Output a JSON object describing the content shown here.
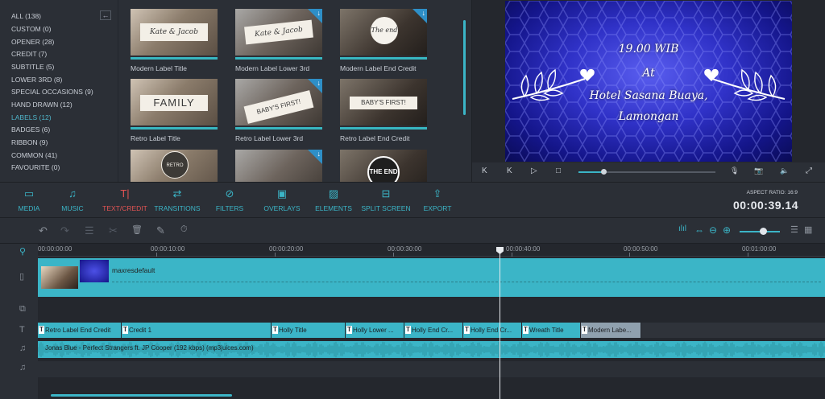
{
  "library": {
    "categories": [
      {
        "label": "ALL (138)"
      },
      {
        "label": "CUSTOM (0)"
      },
      {
        "label": "OPENER (28)"
      },
      {
        "label": "CREDIT (7)"
      },
      {
        "label": "SUBTITLE (5)"
      },
      {
        "label": "LOWER 3RD (8)"
      },
      {
        "label": "SPECIAL OCCASIONS (9)"
      },
      {
        "label": "HAND DRAWN (12)"
      },
      {
        "label": "LABELS (12)"
      },
      {
        "label": "BADGES (6)"
      },
      {
        "label": "RIBBON (9)"
      },
      {
        "label": "COMMON (41)"
      },
      {
        "label": "FAVOURITE (0)"
      }
    ],
    "active_category": "LABELS (12)",
    "collapse_glyph": "←",
    "thumbnails": [
      {
        "label": "Modern Label Title",
        "art": "Kate & Jacob",
        "download": false
      },
      {
        "label": "Modern Label Lower 3rd",
        "art": "Kate & Jacob",
        "download": true
      },
      {
        "label": "Modern Label End Credit",
        "art": "The end",
        "download": true
      },
      {
        "label": "Retro Label Title",
        "art": "FAMILY",
        "download": false
      },
      {
        "label": "Retro Label Lower 3rd",
        "art": "BABY'S FIRST!",
        "download": true
      },
      {
        "label": "Retro Label End Credit",
        "art": "BABY'S FIRST!",
        "download": false
      },
      {
        "label": "",
        "art": "RETRO LABELS",
        "download": false
      },
      {
        "label": "",
        "art": "",
        "download": true
      },
      {
        "label": "",
        "art": "THE END",
        "download": false
      }
    ],
    "download_glyph": "↓"
  },
  "preview": {
    "lines": [
      "19.00 WIB",
      "At",
      "Hotel Sasana Buaya,",
      "Lamongan"
    ],
    "controls": {
      "prev": "K",
      "step_back": "K",
      "play": "▷",
      "stop": "□",
      "progress": 0.18,
      "mic": "🎙",
      "snapshot": "📷",
      "volume": "🔈",
      "fullscreen": "⤢"
    }
  },
  "toolbar": {
    "tools": [
      {
        "label": "MEDIA",
        "icon": "folder-icon",
        "glyph": "▭"
      },
      {
        "label": "MUSIC",
        "icon": "music-icon",
        "glyph": "♫"
      },
      {
        "label": "TEXT/CREDIT",
        "icon": "text-icon",
        "glyph": "T|"
      },
      {
        "label": "TRANSITIONS",
        "icon": "transitions-icon",
        "glyph": "⇄"
      },
      {
        "label": "FILTERS",
        "icon": "filters-icon",
        "glyph": "⊘"
      },
      {
        "label": "OVERLAYS",
        "icon": "overlays-icon",
        "glyph": "▣"
      },
      {
        "label": "ELEMENTS",
        "icon": "elements-icon",
        "glyph": "▨"
      },
      {
        "label": "SPLIT SCREEN",
        "icon": "split-screen-icon",
        "glyph": "⊟"
      },
      {
        "label": "EXPORT",
        "icon": "export-icon",
        "glyph": "⇪"
      }
    ],
    "active_tool": "TEXT/CREDIT",
    "aspect_ratio": "ASPECT RATIO: 16:9",
    "timecode": "00:00:39.14"
  },
  "editbar": {
    "undo": "↶",
    "redo": "↷",
    "settings": "☰",
    "cut": "✂",
    "delete": "🗑",
    "edit": "✎",
    "duration": "⏱",
    "right": {
      "audio_mix": "ılıl",
      "fit": "⇔",
      "zoom_out": "⊖",
      "zoom_in": "⊕",
      "zoom_level": 0.5,
      "list": "☰",
      "grid": "▦"
    }
  },
  "timeline": {
    "ruler": [
      "00:00:00:00",
      "00:00:10:00",
      "00:00:20:00",
      "00:00:30:00",
      "00:00:40:00",
      "00:00:50:00",
      "00:01:00:00"
    ],
    "track_icons": {
      "video": "▯",
      "overlay": "⧉",
      "text": "T",
      "music": "♫",
      "music2": "♫",
      "link": "⚲"
    },
    "video_clip_label": "maxresdefault",
    "text_clips": [
      {
        "label": "Retro Label End Credit",
        "selected": false
      },
      {
        "label": "Credit 1",
        "selected": false
      },
      {
        "label": "Holly Title",
        "selected": false
      },
      {
        "label": "Holly Lower ...",
        "selected": false
      },
      {
        "label": "Holly End Cr...",
        "selected": false
      },
      {
        "label": "Holly End Cr...",
        "selected": false
      },
      {
        "label": "Wreath Title",
        "selected": false
      },
      {
        "label": "Modern Labe...",
        "selected": true
      }
    ],
    "audio_label": "Jonas Blue - Perfect Strangers ft. JP Cooper (192 kbps) (mp3juices.com)",
    "playhead_time": "00:00:39.14"
  },
  "colors": {
    "accent": "#3bb5c7",
    "active": "#e05353",
    "bg": "#2b2f36"
  }
}
